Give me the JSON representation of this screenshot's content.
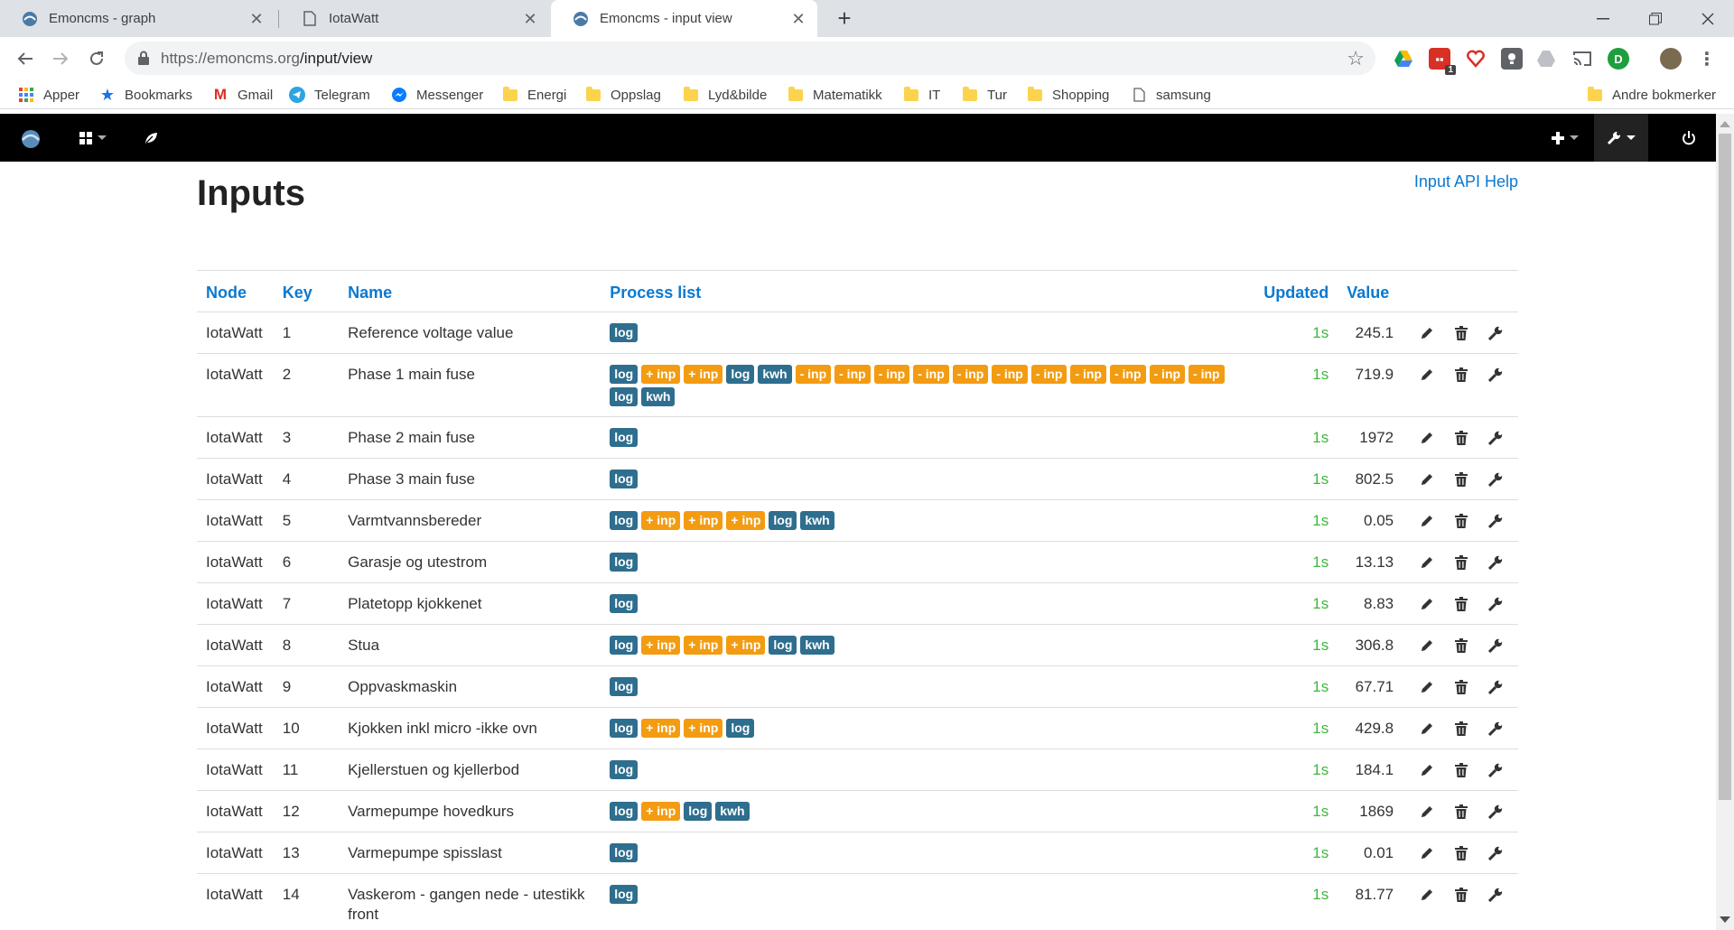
{
  "browser": {
    "tabs": [
      {
        "title": "Emoncms - graph",
        "active": false
      },
      {
        "title": "IotaWatt",
        "active": false
      },
      {
        "title": "Emoncms - input view",
        "active": true
      }
    ],
    "url_host": "https://emoncms.org",
    "url_path": "/input/view",
    "bookmarks": [
      {
        "label": "Apper",
        "icon": "apps-grid-icon"
      },
      {
        "label": "Bookmarks",
        "icon": "star-icon"
      },
      {
        "label": "Gmail",
        "icon": "gmail-icon"
      },
      {
        "label": "Telegram",
        "icon": "telegram-icon"
      },
      {
        "label": "Messenger",
        "icon": "messenger-icon"
      },
      {
        "label": "Energi",
        "icon": "folder-icon"
      },
      {
        "label": "Oppslag",
        "icon": "folder-icon"
      },
      {
        "label": "Lyd&bilde",
        "icon": "folder-icon"
      },
      {
        "label": "Matematikk",
        "icon": "folder-icon"
      },
      {
        "label": "IT",
        "icon": "folder-icon"
      },
      {
        "label": "Tur",
        "icon": "folder-icon"
      },
      {
        "label": "Shopping",
        "icon": "folder-icon"
      },
      {
        "label": "samsung",
        "icon": "page-icon"
      }
    ],
    "other_bookmarks": "Andre bokmerker",
    "extension_badge": "1"
  },
  "page": {
    "title": "Inputs",
    "api_help": "Input API Help",
    "columns": {
      "node": "Node",
      "key": "Key",
      "name": "Name",
      "process_list": "Process list",
      "updated": "Updated",
      "value": "Value"
    },
    "rows": [
      {
        "node": "IotaWatt",
        "key": "1",
        "name": "Reference voltage value",
        "process": [
          "log"
        ],
        "updated": "1s",
        "value": "245.1"
      },
      {
        "node": "IotaWatt",
        "key": "2",
        "name": "Phase 1 main fuse",
        "process": [
          "log",
          "+ inp",
          "+ inp",
          "log",
          "kwh",
          "- inp",
          "- inp",
          "- inp",
          "- inp",
          "- inp",
          "- inp",
          "- inp",
          "- inp",
          "- inp",
          "- inp",
          "- inp",
          "log",
          "kwh"
        ],
        "updated": "1s",
        "value": "719.9"
      },
      {
        "node": "IotaWatt",
        "key": "3",
        "name": "Phase 2 main fuse",
        "process": [
          "log"
        ],
        "updated": "1s",
        "value": "1972"
      },
      {
        "node": "IotaWatt",
        "key": "4",
        "name": "Phase 3 main fuse",
        "process": [
          "log"
        ],
        "updated": "1s",
        "value": "802.5"
      },
      {
        "node": "IotaWatt",
        "key": "5",
        "name": "Varmtvannsbereder",
        "process": [
          "log",
          "+ inp",
          "+ inp",
          "+ inp",
          "log",
          "kwh"
        ],
        "updated": "1s",
        "value": "0.05"
      },
      {
        "node": "IotaWatt",
        "key": "6",
        "name": "Garasje og utestrom",
        "process": [
          "log"
        ],
        "updated": "1s",
        "value": "13.13"
      },
      {
        "node": "IotaWatt",
        "key": "7",
        "name": "Platetopp kjokkenet",
        "process": [
          "log"
        ],
        "updated": "1s",
        "value": "8.83"
      },
      {
        "node": "IotaWatt",
        "key": "8",
        "name": "Stua",
        "process": [
          "log",
          "+ inp",
          "+ inp",
          "+ inp",
          "log",
          "kwh"
        ],
        "updated": "1s",
        "value": "306.8"
      },
      {
        "node": "IotaWatt",
        "key": "9",
        "name": "Oppvaskmaskin",
        "process": [
          "log"
        ],
        "updated": "1s",
        "value": "67.71"
      },
      {
        "node": "IotaWatt",
        "key": "10",
        "name": "Kjokken inkl micro -ikke ovn",
        "process": [
          "log",
          "+ inp",
          "+ inp",
          "log"
        ],
        "updated": "1s",
        "value": "429.8"
      },
      {
        "node": "IotaWatt",
        "key": "11",
        "name": "Kjellerstuen og kjellerbod",
        "process": [
          "log"
        ],
        "updated": "1s",
        "value": "184.1"
      },
      {
        "node": "IotaWatt",
        "key": "12",
        "name": "Varmepumpe hovedkurs",
        "process": [
          "log",
          "+ inp",
          "log",
          "kwh"
        ],
        "updated": "1s",
        "value": "1869"
      },
      {
        "node": "IotaWatt",
        "key": "13",
        "name": "Varmepumpe spisslast",
        "process": [
          "log"
        ],
        "updated": "1s",
        "value": "0.01"
      },
      {
        "node": "IotaWatt",
        "key": "14",
        "name": "Vaskerom - gangen nede - utestikk front",
        "process": [
          "log"
        ],
        "updated": "1s",
        "value": "81.77"
      }
    ]
  },
  "colors": {
    "accent": "#0b79d0",
    "log_badge": "#2e6e8e",
    "inp_badge": "#f39c12",
    "updated_green": "#3cb83c"
  }
}
